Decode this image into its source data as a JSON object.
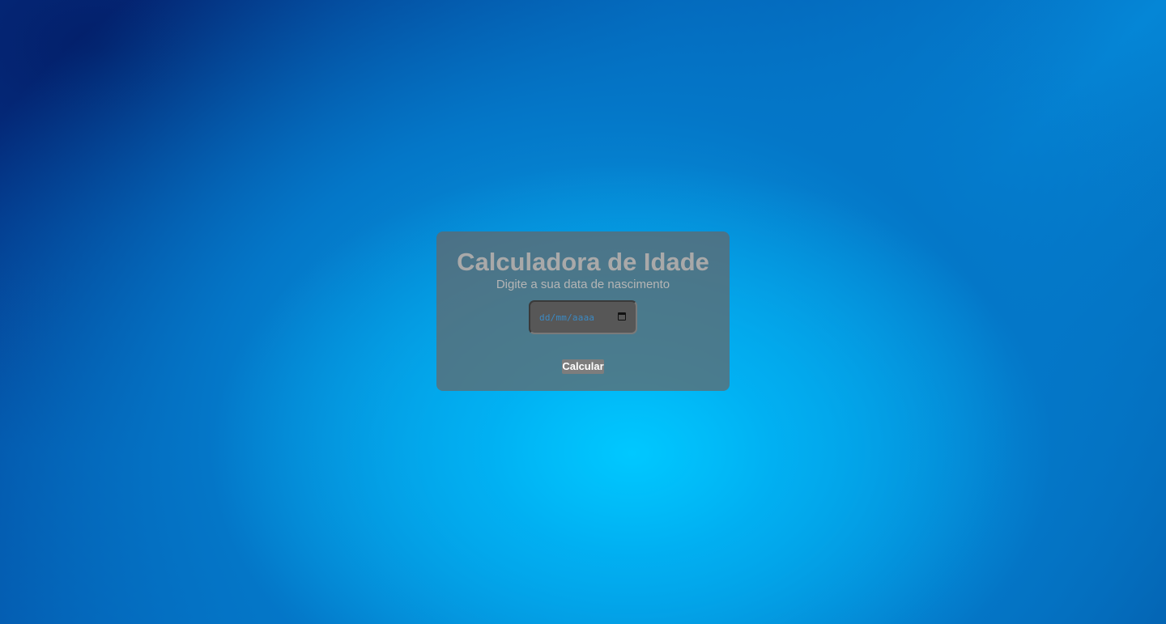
{
  "calculator": {
    "title": "Calculadora de Idade",
    "subtitle": "Digite a sua data de nascimento",
    "date_placeholder": "dd/mm/aaaa",
    "calculate_label": "Calcular"
  },
  "icons": {
    "date_picker": "calendar-icon"
  }
}
